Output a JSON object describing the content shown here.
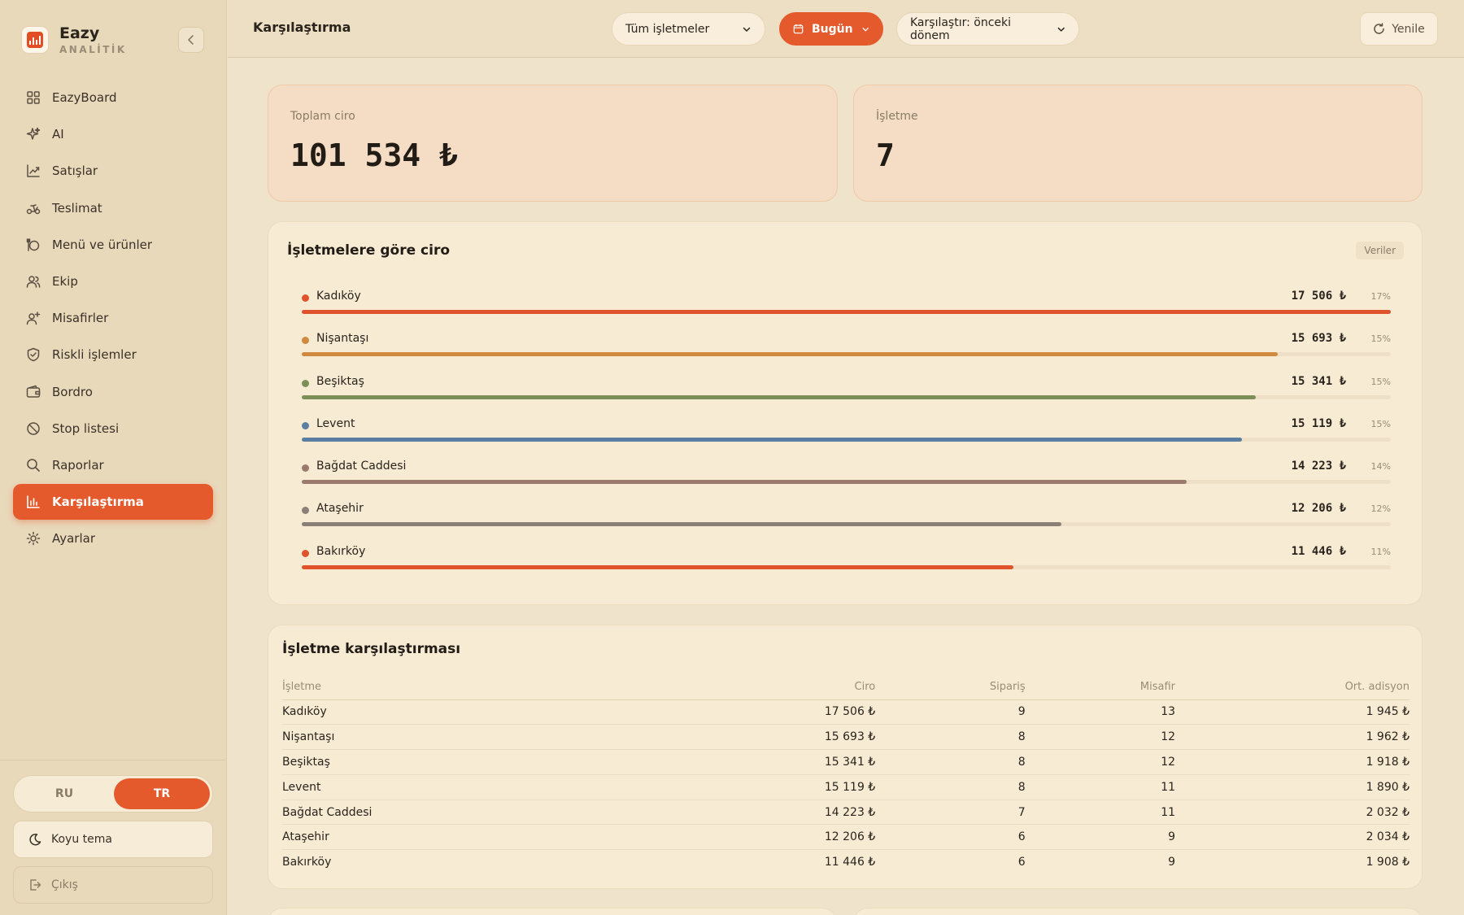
{
  "brand": {
    "name": "Eazy",
    "subtitle": "ANALİTİK"
  },
  "sidebar": {
    "items": [
      {
        "label": "EazyBoard",
        "icon": "grid-icon"
      },
      {
        "label": "AI",
        "icon": "sparkle-icon"
      },
      {
        "label": "Satışlar",
        "icon": "chart-line-icon"
      },
      {
        "label": "Teslimat",
        "icon": "scooter-icon"
      },
      {
        "label": "Menü ve ürünler",
        "icon": "dish-icon"
      },
      {
        "label": "Ekip",
        "icon": "team-icon"
      },
      {
        "label": "Misafirler",
        "icon": "guest-add-icon"
      },
      {
        "label": "Riskli işlemler",
        "icon": "shield-icon"
      },
      {
        "label": "Bordro",
        "icon": "wallet-icon"
      },
      {
        "label": "Stop listesi",
        "icon": "ban-icon"
      },
      {
        "label": "Raporlar",
        "icon": "search-icon"
      },
      {
        "label": "Karşılaştırma",
        "icon": "bar-chart-icon",
        "active": true
      },
      {
        "label": "Ayarlar",
        "icon": "gear-icon"
      }
    ],
    "languages": {
      "ru": "RU",
      "tr": "TR",
      "selected": "TR"
    },
    "dark_theme_label": "Koyu tema",
    "logout_label": "Çıkış"
  },
  "topbar": {
    "title": "Karşılaştırma",
    "store_filter": "Tüm işletmeler",
    "date_filter": "Bugün",
    "compare_filter": "Karşılaştır: önceki dönem",
    "refresh_label": "Yenile"
  },
  "kpis": {
    "total_revenue_label": "Toplam ciro",
    "total_revenue_value": "101 534 ₺",
    "stores_label": "İşletme",
    "stores_value": "7"
  },
  "revenue_by_store": {
    "title": "İşletmelere göre ciro",
    "data_button": "Veriler"
  },
  "comparison_table": {
    "title": "İşletme karşılaştırması",
    "headers": [
      "İşletme",
      "Ciro",
      "Sipariş",
      "Misafir",
      "Ort. adisyon"
    ],
    "rows": [
      [
        "Kadıköy",
        "17 506 ₺",
        "9",
        "13",
        "1 945 ₺"
      ],
      [
        "Nişantaşı",
        "15 693 ₺",
        "8",
        "12",
        "1 962 ₺"
      ],
      [
        "Beşiktaş",
        "15 341 ₺",
        "8",
        "12",
        "1 918 ₺"
      ],
      [
        "Levent",
        "15 119 ₺",
        "8",
        "11",
        "1 890 ₺"
      ],
      [
        "Bağdat Caddesi",
        "14 223 ₺",
        "7",
        "11",
        "2 032 ₺"
      ],
      [
        "Ataşehir",
        "12 206 ₺",
        "6",
        "9",
        "2 034 ₺"
      ],
      [
        "Bakırköy",
        "11 446 ₺",
        "6",
        "9",
        "1 908 ₺"
      ]
    ]
  },
  "chart_data": {
    "type": "bar",
    "title": "İşletmelere göre ciro",
    "categories": [
      "Kadıköy",
      "Nişantaşı",
      "Beşiktaş",
      "Levent",
      "Bağdat Caddesi",
      "Ataşehir",
      "Bakırköy"
    ],
    "values": [
      17506,
      15693,
      15341,
      15119,
      14223,
      12206,
      11446
    ],
    "value_labels": [
      "17 506 ₺",
      "15 693 ₺",
      "15 341 ₺",
      "15 119 ₺",
      "14 223 ₺",
      "12 206 ₺",
      "11 446 ₺"
    ],
    "percent_labels": [
      "17%",
      "15%",
      "15%",
      "15%",
      "14%",
      "12%",
      "11%"
    ],
    "colors": [
      "#e0522b",
      "#d08a3f",
      "#7b8f57",
      "#5b7fa1",
      "#9b7a6d",
      "#8b8078",
      "#e0522b"
    ],
    "orientation": "horizontal",
    "legend": "none"
  }
}
